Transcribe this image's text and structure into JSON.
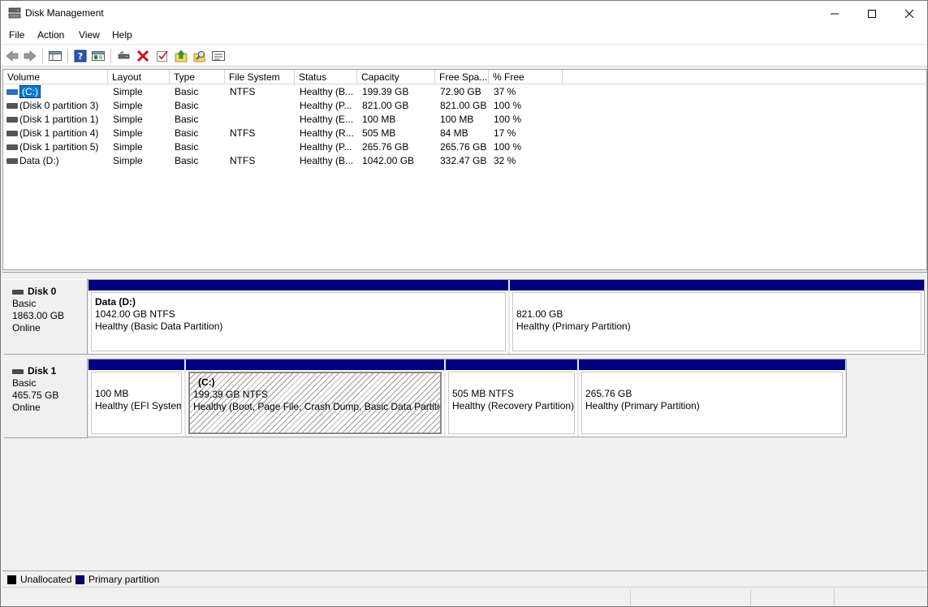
{
  "window": {
    "title": "Disk Management"
  },
  "menu": [
    "File",
    "Action",
    "View",
    "Help"
  ],
  "toolbar": [
    "back-icon",
    "forward-icon",
    "console-tree-icon",
    "help-icon",
    "properties-view-icon",
    "connect-icon",
    "delete-icon",
    "check-icon",
    "import-icon",
    "search-icon",
    "list-icon"
  ],
  "volume_table": {
    "columns": [
      "Volume",
      "Layout",
      "Type",
      "File System",
      "Status",
      "Capacity",
      "Free Spa...",
      "% Free"
    ],
    "rows": [
      [
        "(C:)",
        "Simple",
        "Basic",
        "NTFS",
        "Healthy (B...",
        "199.39 GB",
        "72.90 GB",
        "37 %"
      ],
      [
        "(Disk 0 partition 3)",
        "Simple",
        "Basic",
        "",
        "Healthy (P...",
        "821.00 GB",
        "821.00 GB",
        "100 %"
      ],
      [
        "(Disk 1 partition 1)",
        "Simple",
        "Basic",
        "",
        "Healthy (E...",
        "100 MB",
        "100 MB",
        "100 %"
      ],
      [
        "(Disk 1 partition 4)",
        "Simple",
        "Basic",
        "NTFS",
        "Healthy (R...",
        "505 MB",
        "84 MB",
        "17 %"
      ],
      [
        "(Disk 1 partition 5)",
        "Simple",
        "Basic",
        "",
        "Healthy (P...",
        "265.76 GB",
        "265.76 GB",
        "100 %"
      ],
      [
        "Data (D:)",
        "Simple",
        "Basic",
        "NTFS",
        "Healthy (B...",
        "1042.00 GB",
        "332.47 GB",
        "32 %"
      ]
    ]
  },
  "disks": [
    {
      "name": "Disk 0",
      "type": "Basic",
      "size": "1863.00 GB",
      "state": "Online",
      "partitions": [
        {
          "label": "Data  (D:)",
          "line1": "1042.00 GB NTFS",
          "line2": "Healthy (Basic Data Partition)"
        },
        {
          "label": "",
          "line1": "821.00 GB",
          "line2": "Healthy (Primary Partition)"
        }
      ]
    },
    {
      "name": "Disk 1",
      "type": "Basic",
      "size": "465.75 GB",
      "state": "Online",
      "partitions": [
        {
          "label": "",
          "line1": "100 MB",
          "line2": "Healthy (EFI System"
        },
        {
          "label": "(C:)",
          "line1": "199.39 GB NTFS",
          "line2": "Healthy (Boot, Page File, Crash Dump, Basic Data Partition"
        },
        {
          "label": "",
          "line1": "505 MB NTFS",
          "line2": "Healthy (Recovery Partition)"
        },
        {
          "label": "",
          "line1": "265.76 GB",
          "line2": "Healthy (Primary Partition)"
        }
      ]
    }
  ],
  "legend": [
    {
      "label": "Unallocated",
      "color": "#000000"
    },
    {
      "label": "Primary partition",
      "color": "#000080"
    }
  ]
}
